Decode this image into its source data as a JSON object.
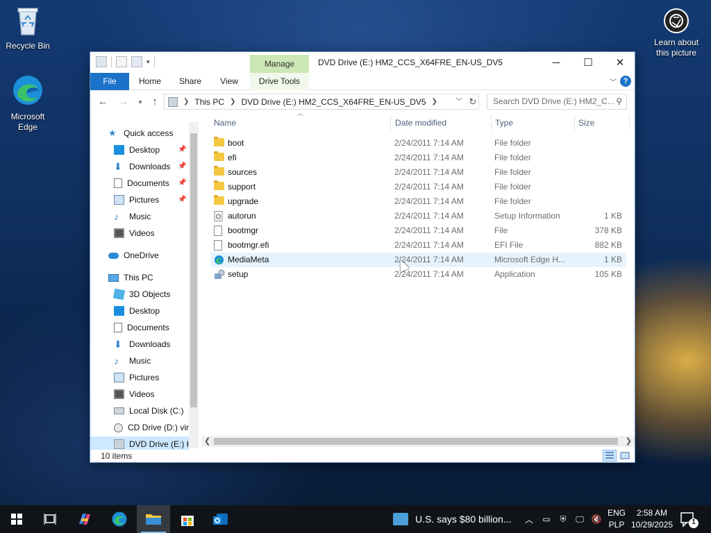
{
  "desktop": {
    "recycle_bin": "Recycle Bin",
    "edge_label": "Microsoft Edge",
    "learn_line1": "Learn about",
    "learn_line2": "this picture"
  },
  "window": {
    "title": "DVD Drive (E:) HM2_CCS_X64FRE_EN-US_DV5",
    "manage_tab": "Manage",
    "ribbon_tabs": [
      "File",
      "Home",
      "Share",
      "View",
      "Drive Tools"
    ],
    "address_crumbs": [
      "This PC",
      "DVD Drive (E:) HM2_CCS_X64FRE_EN-US_DV5"
    ],
    "search_placeholder": "Search DVD Drive (E:) HM2_C...",
    "columns": [
      "Name",
      "Date modified",
      "Type",
      "Size"
    ],
    "status": "10 items"
  },
  "nav": {
    "quick_access": "Quick access",
    "quick_items": [
      "Desktop",
      "Downloads",
      "Documents",
      "Pictures",
      "Music",
      "Videos"
    ],
    "onedrive": "OneDrive",
    "this_pc": "This PC",
    "pc_items": [
      "3D Objects",
      "Desktop",
      "Documents",
      "Downloads",
      "Music",
      "Pictures",
      "Videos",
      "Local Disk (C:)",
      "CD Drive (D:) virt",
      "DVD Drive (E:) H"
    ]
  },
  "files": [
    {
      "name": "boot",
      "date": "2/24/2011 7:14 AM",
      "type": "File folder",
      "size": "",
      "icon": "folder-icon"
    },
    {
      "name": "efi",
      "date": "2/24/2011 7:14 AM",
      "type": "File folder",
      "size": "",
      "icon": "folder-icon"
    },
    {
      "name": "sources",
      "date": "2/24/2011 7:14 AM",
      "type": "File folder",
      "size": "",
      "icon": "folder-icon"
    },
    {
      "name": "support",
      "date": "2/24/2011 7:14 AM",
      "type": "File folder",
      "size": "",
      "icon": "folder-icon"
    },
    {
      "name": "upgrade",
      "date": "2/24/2011 7:14 AM",
      "type": "File folder",
      "size": "",
      "icon": "folder-icon"
    },
    {
      "name": "autorun",
      "date": "2/24/2011 7:14 AM",
      "type": "Setup Information",
      "size": "1 KB",
      "icon": "setup-info-icon"
    },
    {
      "name": "bootmgr",
      "date": "2/24/2011 7:14 AM",
      "type": "File",
      "size": "378 KB",
      "icon": "file-icon"
    },
    {
      "name": "bootmgr.efi",
      "date": "2/24/2011 7:14 AM",
      "type": "EFI File",
      "size": "882 KB",
      "icon": "file-icon"
    },
    {
      "name": "MediaMeta",
      "date": "2/24/2011 7:14 AM",
      "type": "Microsoft Edge H...",
      "size": "1 KB",
      "icon": "edge-icon"
    },
    {
      "name": "setup",
      "date": "2/24/2011 7:14 AM",
      "type": "Application",
      "size": "105 KB",
      "icon": "setup-app-icon"
    }
  ],
  "taskbar": {
    "news": "U.S. says $80 billion...",
    "lang_line1": "ENG",
    "lang_line2": "PLP",
    "time": "2:58 AM",
    "date": "10/29/2025",
    "notification_count": "1"
  },
  "colors": {
    "accent": "#1a73c8",
    "manage": "#cbe7b6",
    "selected": "#cde8ff"
  }
}
